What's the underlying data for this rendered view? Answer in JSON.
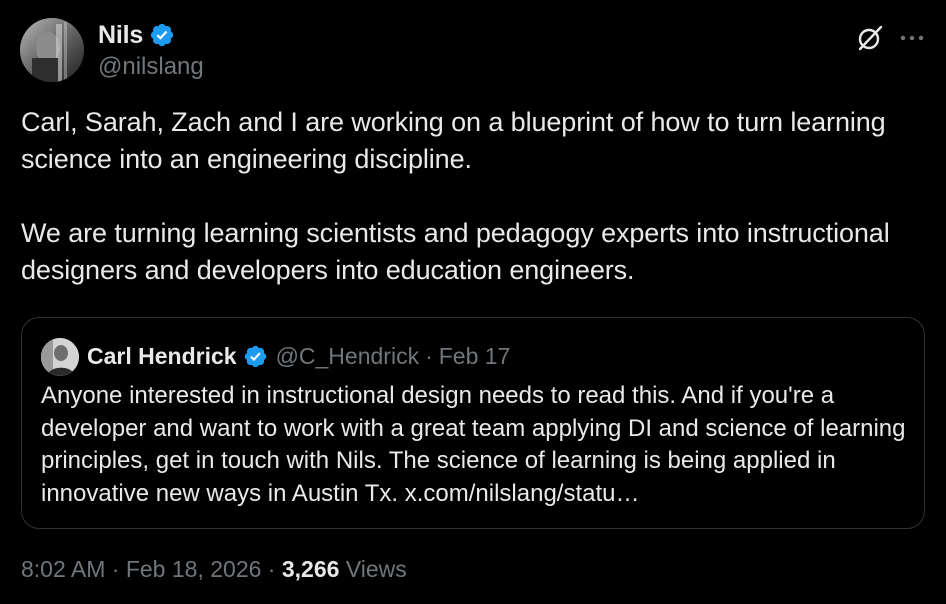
{
  "author": {
    "name": "Nils",
    "handle": "@nilslang",
    "verified": true
  },
  "tweet": {
    "paragraphs": [
      "Carl, Sarah, Zach and I are working on a blueprint of how to turn learning science into an engineering discipline.",
      "We are turning learning scientists and pedagogy experts into instructional designers and developers into education engineers."
    ]
  },
  "quote": {
    "name": "Carl Hendrick",
    "handle": "@C_Hendrick",
    "separator": "·",
    "date": "Feb 17",
    "verified": true,
    "text": "Anyone interested in instructional design needs to read this. And if you're a developer and want to work with a great team applying DI and science of learning principles, get in touch with Nils. The science of learning is being applied in innovative new ways in Austin Tx. x.com/nilslang/statu…"
  },
  "meta": {
    "time": "8:02 AM",
    "separator": "·",
    "date": "Feb 18, 2026",
    "views_count": "3,266",
    "views_label": "Views"
  },
  "icons": {
    "verified": "verified-badge-icon",
    "grok": "grok-icon",
    "more": "more-options-icon"
  },
  "colors": {
    "background": "#000000",
    "text": "#e7e9ea",
    "secondary": "#71767b",
    "verified": "#1d9bf0",
    "border": "#2f3336"
  }
}
